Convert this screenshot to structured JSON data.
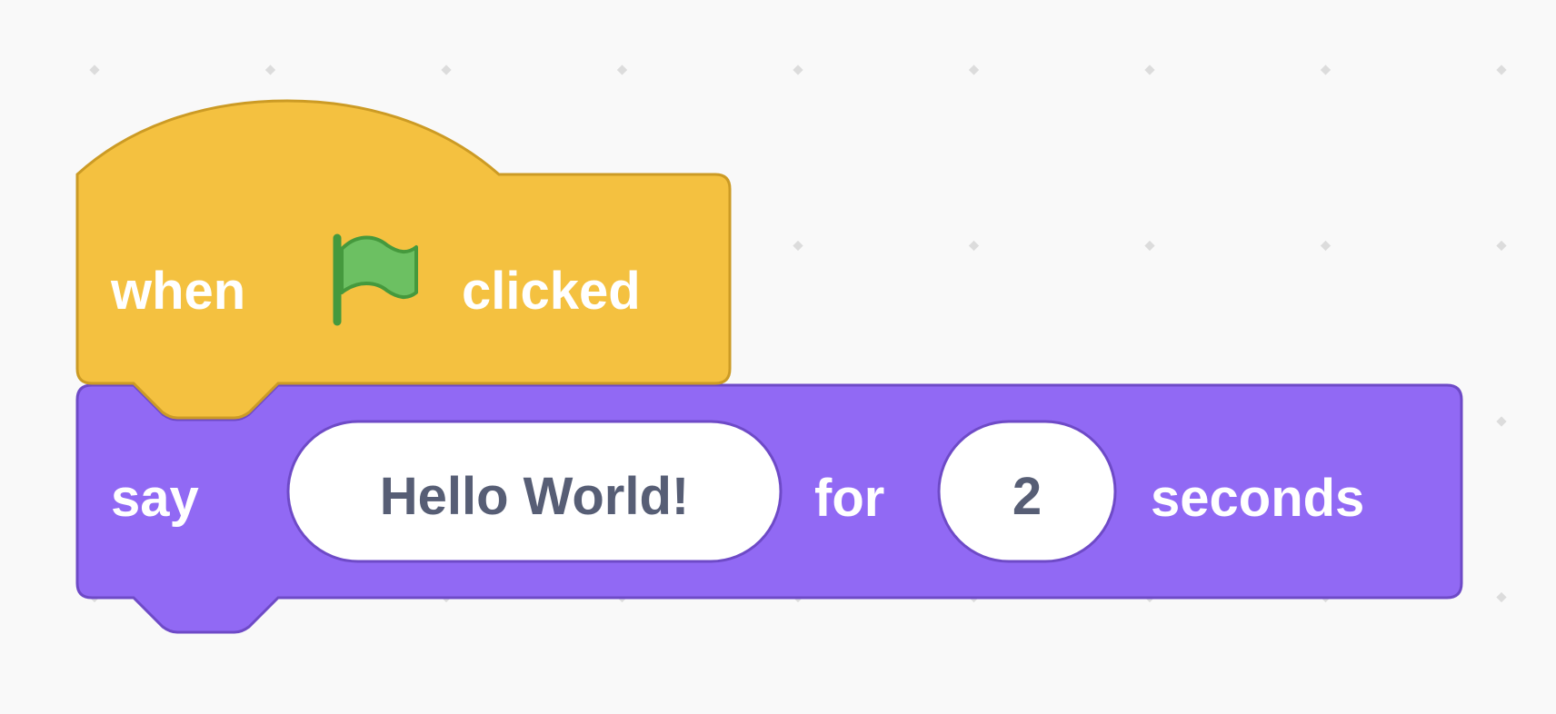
{
  "colors": {
    "workspace_bg": "#f9f9f9",
    "grid_dot": "#dcdcdc",
    "events_fill": "#f4c140",
    "events_stroke": "#cc9b25",
    "looks_fill": "#9169f4",
    "looks_stroke": "#6e4ac7",
    "flag_fill": "#6cc062",
    "flag_stroke": "#45993d",
    "field_text": "#575e75"
  },
  "hat_block": {
    "category": "events",
    "label_before": "when",
    "icon": "green-flag-icon",
    "label_after": "clicked"
  },
  "say_block": {
    "category": "looks",
    "label_say": "say",
    "message": "Hello World!",
    "label_for": "for",
    "duration": "2",
    "label_seconds": "seconds"
  }
}
